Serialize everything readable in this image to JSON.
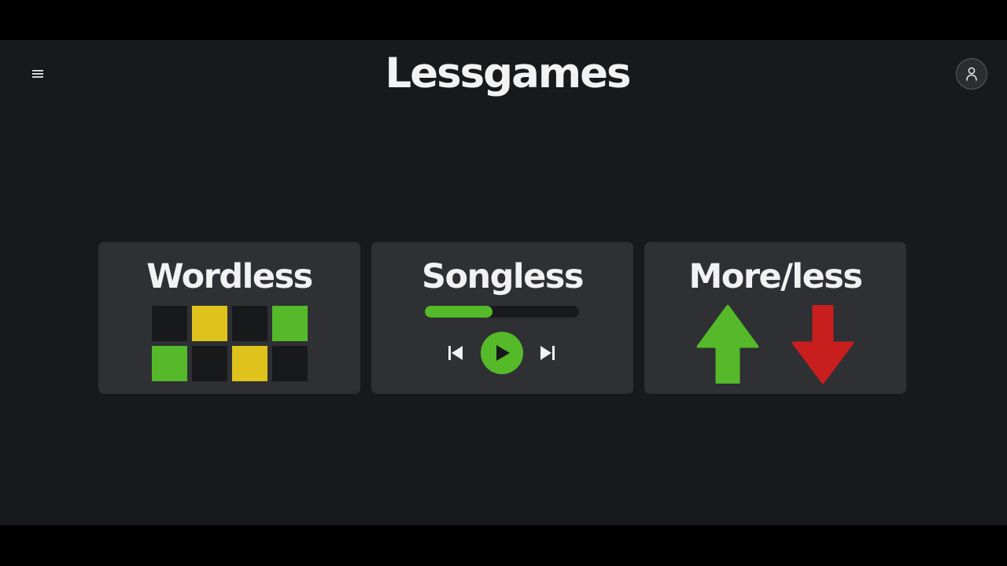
{
  "header": {
    "title": "Lessgames",
    "menu_icon": "hamburger-menu-icon",
    "profile_icon": "user-icon"
  },
  "colors": {
    "background": "#18191b",
    "card": "#2e3034",
    "green": "#55b92a",
    "yellow": "#dfc31c",
    "red": "#c81e1e",
    "dark_tile": "#18191b",
    "text": "#f2f2f2"
  },
  "cards": [
    {
      "title": "Wordless",
      "tiles": [
        [
          "dark",
          "yellow",
          "dark",
          "green"
        ],
        [
          "green",
          "dark",
          "yellow",
          "dark"
        ]
      ]
    },
    {
      "title": "Songless",
      "progress": 0.44,
      "icons": [
        "skip-back-icon",
        "play-icon",
        "skip-forward-icon"
      ]
    },
    {
      "title": "More/less",
      "icons": [
        "arrow-up-icon",
        "arrow-down-icon"
      ]
    }
  ]
}
